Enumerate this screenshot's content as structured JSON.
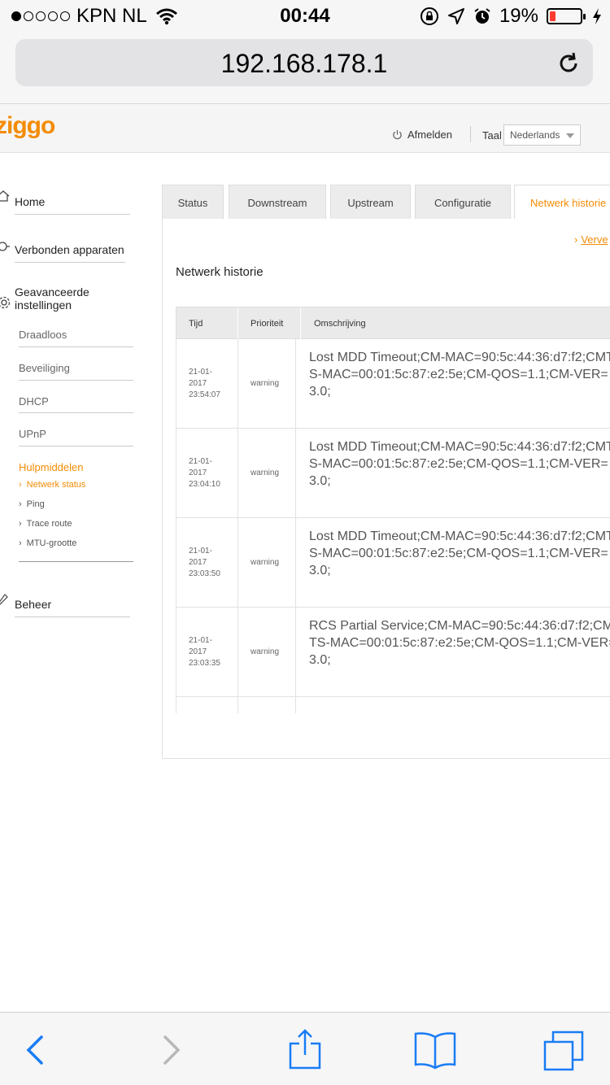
{
  "status_bar": {
    "carrier": "KPN NL",
    "time": "00:44",
    "battery_percent": "19%",
    "battery_level": 0.19,
    "battery_color": "#ff3b30"
  },
  "browser": {
    "url": "192.168.178.1"
  },
  "header": {
    "logo": "ziggo",
    "logout_label": "Afmelden",
    "language_label": "Taal",
    "language_value": "Nederlands"
  },
  "sidebar": {
    "home": "Home",
    "connected_devices": "Verbonden apparaten",
    "advanced_line1": "Geavanceerde",
    "advanced_line2": "instellingen",
    "sub_items": [
      "Draadloos",
      "Beveiliging",
      "DHCP",
      "UPnP"
    ],
    "tools_label": "Hulpmiddelen",
    "tools_items": [
      "Netwerk status",
      "Ping",
      "Trace route",
      "MTU-grootte"
    ],
    "management": "Beheer"
  },
  "tabs": [
    "Status",
    "Downstream",
    "Upstream",
    "Configuratie",
    "Netwerk historie"
  ],
  "refresh_link": "Verve",
  "section_title": "Netwerk historie",
  "table": {
    "headers": [
      "Tijd",
      "Prioriteit",
      "Omschrijving"
    ],
    "rows": [
      {
        "date": "21-01-",
        "year": "2017",
        "time": "23:54:07",
        "priority": "warning",
        "description": "Lost MDD Timeout;CM-MAC=90:5c:44:36:d7:f2;CMTS-MAC=00:01:5c:87:e2:5e;CM-QOS=1.1;CM-VER=3.0;"
      },
      {
        "date": "21-01-",
        "year": "2017",
        "time": "23:04:10",
        "priority": "warning",
        "description": "Lost MDD Timeout;CM-MAC=90:5c:44:36:d7:f2;CMTS-MAC=00:01:5c:87:e2:5e;CM-QOS=1.1;CM-VER=3.0;"
      },
      {
        "date": "21-01-",
        "year": "2017",
        "time": "23:03:50",
        "priority": "warning",
        "description": "Lost MDD Timeout;CM-MAC=90:5c:44:36:d7:f2;CMTS-MAC=00:01:5c:87:e2:5e;CM-QOS=1.1;CM-VER=3.0;"
      },
      {
        "date": "21-01-",
        "year": "2017",
        "time": "23:03:35",
        "priority": "warning",
        "description": "RCS Partial Service;CM-MAC=90:5c:44:36:d7:f2;CMTS-MAC=00:01:5c:87:e2:5e;CM-QOS=1.1;CM-VER=3.0;"
      }
    ]
  },
  "colors": {
    "accent": "#f48c06",
    "ios_blue": "#1a7cf5"
  }
}
